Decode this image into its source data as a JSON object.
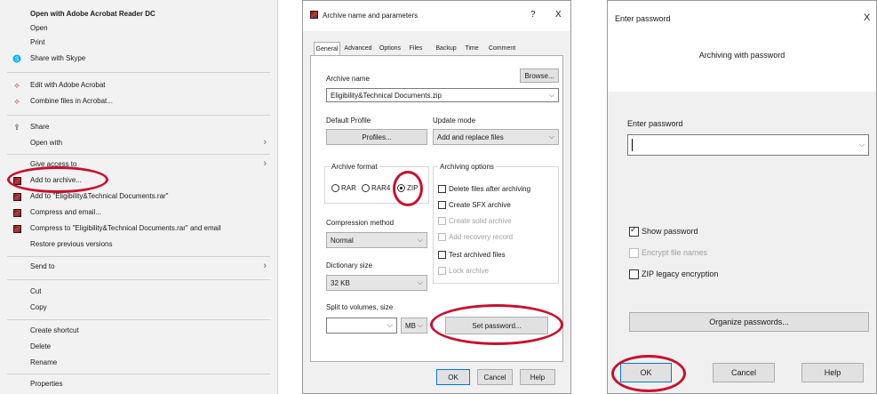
{
  "context_menu": {
    "items": [
      {
        "label": "Open with Adobe Acrobat Reader DC",
        "bold": true,
        "icon": ""
      },
      {
        "label": "Open",
        "icon": ""
      },
      {
        "label": "Print",
        "icon": ""
      },
      {
        "label": "Share with Skype",
        "icon": "skype-icon"
      },
      {
        "label": "Edit with Adobe Acrobat",
        "icon": "acrobat-icon"
      },
      {
        "label": "Combine files in Acrobat...",
        "icon": "acrobat-icon"
      },
      {
        "label": "Share",
        "icon": "share-icon"
      },
      {
        "label": "Open with",
        "icon": "",
        "submenu": true
      },
      {
        "label": "Give access to",
        "icon": "",
        "submenu": true
      },
      {
        "label": "Add to archive...",
        "icon": "winrar-icon"
      },
      {
        "label": "Add to \"Eligibility&Technical Documents.rar\"",
        "icon": "winrar-icon"
      },
      {
        "label": "Compress and email...",
        "icon": "winrar-icon"
      },
      {
        "label": "Compress to \"Eligibility&Technical Documents.rar\" and email",
        "icon": "winrar-icon"
      },
      {
        "label": "Restore previous versions",
        "icon": ""
      },
      {
        "label": "Send to",
        "icon": "",
        "submenu": true
      },
      {
        "label": "Cut",
        "icon": ""
      },
      {
        "label": "Copy",
        "icon": ""
      },
      {
        "label": "Create shortcut",
        "icon": ""
      },
      {
        "label": "Delete",
        "icon": ""
      },
      {
        "label": "Rename",
        "icon": ""
      },
      {
        "label": "Properties",
        "icon": ""
      }
    ]
  },
  "archive_dialog": {
    "title": "Archive name and parameters",
    "help_glyph": "?",
    "close_glyph": "X",
    "tabs": [
      "General",
      "Advanced",
      "Options",
      "Files",
      "Backup",
      "Time",
      "Comment"
    ],
    "archive_name_label": "Archive name",
    "browse_label": "Browse...",
    "archive_name_value": "Eligibility&Technical Documents.zip",
    "default_profile_label": "Default Profile",
    "profiles_label": "Profiles...",
    "update_mode_label": "Update mode",
    "update_mode_value": "Add and replace files",
    "archive_format_label": "Archive format",
    "formats": [
      "RAR",
      "RAR4",
      "ZIP"
    ],
    "selected_format": "ZIP",
    "archiving_options_label": "Archiving options",
    "options": [
      {
        "label": "Delete files after archiving",
        "enabled": true,
        "checked": false
      },
      {
        "label": "Create SFX archive",
        "enabled": true,
        "checked": false
      },
      {
        "label": "Create solid archive",
        "enabled": false,
        "checked": false
      },
      {
        "label": "Add recovery record",
        "enabled": false,
        "checked": false
      },
      {
        "label": "Test archived files",
        "enabled": true,
        "checked": false
      },
      {
        "label": "Lock archive",
        "enabled": false,
        "checked": false
      }
    ],
    "compression_method_label": "Compression method",
    "compression_method_value": "Normal",
    "dictionary_size_label": "Dictionary size",
    "dictionary_size_value": "32 KB",
    "split_label": "Split to volumes, size",
    "split_unit": "MB",
    "set_password_label": "Set password...",
    "ok_label": "OK",
    "cancel_label": "Cancel",
    "help_label": "Help"
  },
  "password_dialog": {
    "title": "Enter password",
    "close_glyph": "X",
    "subtitle": "Archiving with password",
    "enter_password_label": "Enter password",
    "password_value": "",
    "show_password_label": "Show password",
    "show_password_checked": true,
    "encrypt_file_names_label": "Encrypt file names",
    "zip_legacy_label": "ZIP legacy encryption",
    "organize_label": "Organize passwords...",
    "ok_label": "OK",
    "cancel_label": "Cancel",
    "help_label": "Help"
  },
  "colors": {
    "highlight_oval": "#c8102e"
  }
}
